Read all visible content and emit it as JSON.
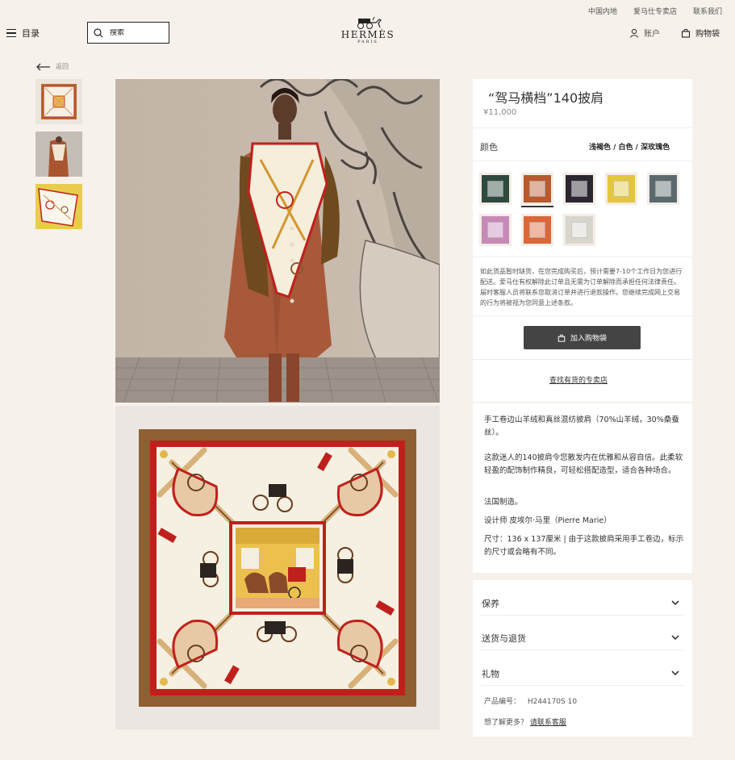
{
  "top_links": [
    "中国内地",
    "爱马仕专卖店",
    "联系我们"
  ],
  "header": {
    "menu_label": "目录",
    "search_placeholder": "搜索",
    "brand": "HERMÈS",
    "brand_city": "PARIS",
    "account_label": "账户",
    "bag_label": "购物袋"
  },
  "back_label": "返回",
  "product": {
    "title": "“驾马横档”140披肩",
    "price": "¥11,000",
    "color_label": "颜色",
    "color_value": "浅褐色 / 白色 / 深玫瑰色",
    "swatches": [
      {
        "name": "green",
        "color": "#2e4a3e"
      },
      {
        "name": "taupe",
        "color": "#b85a2e"
      },
      {
        "name": "navy",
        "color": "#2c2630"
      },
      {
        "name": "yellow",
        "color": "#e3c63e"
      },
      {
        "name": "grey",
        "color": "#5c6a6e"
      },
      {
        "name": "pink",
        "color": "#c789b8"
      },
      {
        "name": "orange",
        "color": "#d9673a"
      },
      {
        "name": "ivory",
        "color": "#d8d5cc"
      }
    ],
    "notice": "如此货品暂时缺货，在您完成购买后，预计需要7-10个工作日为您进行配送。爱马仕有权解除此订单且无需为订单解除而承担任何法律责任。届时客服人员将联系您取消订单并进行退款操作。您继续完成网上交易的行为将被视为您同意上述条款。",
    "add_to_bag": "加入购物袋",
    "find_store": "查找有货的专卖店",
    "description": [
      "手工卷边山羊绒和真丝混纺披肩（70%山羊绒，30%桑蚕丝）。",
      "这款迷人的140披肩令您散发内在优雅和从容自信。此柔软轻盈的配饰制作精良，可轻松搭配造型，适合各种场合。",
      "法国制造。",
      "设计师 皮埃尔·马里（Pierre Marie）",
      "尺寸：136 x 137厘米 | 由于这款披肩采用手工卷边，标示的尺寸或会略有不同。"
    ],
    "accordions": [
      "保养",
      "送货与退货",
      "礼物"
    ],
    "sku_label": "产品编号：",
    "sku": "H244170S 10",
    "help_q": "想了解更多？",
    "help_link": "请联系客服"
  },
  "colors": {
    "page_bg": "#f6f1eb",
    "panel_bg": "#ffffff",
    "button_bg": "#444444",
    "scarf_border": "#8a5a30",
    "scarf_red": "#c0201c"
  }
}
